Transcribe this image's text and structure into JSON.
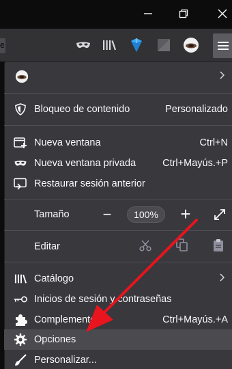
{
  "window": {
    "minimize_icon": "minimize-icon",
    "restore_icon": "restore-icon",
    "close_icon": "close-icon"
  },
  "toolbar": {
    "url_edge_text": "e",
    "icons": [
      "private-browsing-mask-icon",
      "library-icon",
      "vpn-shield-icon",
      "extension-square-icon",
      "account-avatar-icon",
      "hamburger-menu-icon"
    ]
  },
  "menu": {
    "account_chevron": "chevron-right-icon",
    "content_blocking": {
      "label": "Bloqueo de contenido",
      "value": "Personalizado"
    },
    "new_window": {
      "label": "Nueva ventana",
      "shortcut": "Ctrl+N"
    },
    "new_private_window": {
      "label": "Nueva ventana privada",
      "shortcut": "Ctrl+Mayús.+P"
    },
    "restore_session": {
      "label": "Restaurar sesión anterior"
    },
    "zoom": {
      "label": "Tamaño",
      "minus": "−",
      "value": "100%",
      "plus": "+"
    },
    "edit": {
      "label": "Editar"
    },
    "library": {
      "label": "Catálogo"
    },
    "logins": {
      "label": "Inicios de sesión y contraseñas"
    },
    "addons": {
      "label": "Complementos",
      "shortcut": "Ctrl+Mayús.+A"
    },
    "options": {
      "label": "Opciones"
    },
    "customize": {
      "label": "Personalizar..."
    }
  },
  "colors": {
    "panel_bg": "#38383d",
    "toolbar_bg": "#323234",
    "titlebar_bg": "#0c0c0d",
    "hover_bg": "#4a4a4f",
    "annotation_arrow": "#e8141e",
    "vpn_shield": "#3fa9f5"
  }
}
